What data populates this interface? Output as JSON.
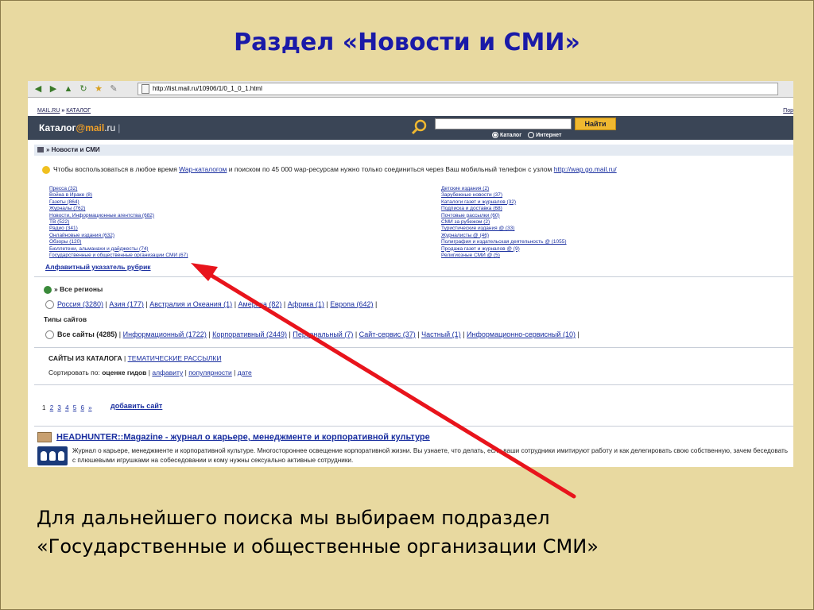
{
  "slide": {
    "title": "Раздел «Новости и СМИ»",
    "caption_line1": "Для дальнейшего поиска мы выбираем подраздел",
    "caption_line2": "«Государственные и общественные организации СМИ»"
  },
  "browser": {
    "url": "http://list.mail.ru/10906/1/0_1_0_1.html",
    "toolbar_icons": [
      "back-icon",
      "forward-icon",
      "up-icon",
      "refresh-icon",
      "favorites-icon",
      "edit-icon"
    ]
  },
  "site": {
    "breadcrumb": {
      "part1": "MAIL.RU",
      "sep": " » ",
      "part2": "КАТАЛОГ"
    },
    "breadcrumb_right": "Пор",
    "logo": {
      "word": "Каталог",
      "at": "@mail",
      "ru": ".ru",
      "bar": "|"
    },
    "search": {
      "button": "Найти",
      "opt1": "Каталог",
      "opt2": "Интернет"
    },
    "section": "» Новости и СМИ",
    "notice": {
      "pre": "Чтобы воспользоваться в любое время ",
      "link1": "Wap-каталогом",
      "mid": " и поиском по 45 000 wap-ресурсам нужно только соединиться через Ваш мобильный телефон с узлом ",
      "link2": "http://wap.go.mail.ru/"
    },
    "categories_left": [
      "Пресса (32)",
      "Война в Ираке (8)",
      "Газеты (864)",
      "Журналы (762)",
      "Новости, Информационные агентства (682)",
      "ТВ (522)",
      "Радио (341)",
      "Онлайновые издания (632)",
      "Обзоры (120)",
      "Бюллетени, альманахи и дайджесты (74)",
      "Государственные и общественные организации СМИ (67)"
    ],
    "categories_right": [
      "Детские издания (2)",
      "Зарубежные новости (37)",
      "Каталоги газет и журналов (32)",
      "Подписка и доставка (68)",
      "Почтовые рассылки (60)",
      "СМИ за рубежом (2)",
      "Туристические издания @ (33)",
      "Журналисты @ (46)",
      "Полиграфия и издательская деятельность @ (1055)",
      "Продажа газет и журналов @ (9)",
      "Религиозные СМИ @ (5)"
    ],
    "alpha_index": "Алфавитный указатель рубрик",
    "regions_title": "» Все регионы",
    "regions": [
      "Россия (3280)",
      "Азия (177)",
      "Австралия и Океания (1)",
      "Америка (82)",
      "Африка (1)",
      "Европа (642)"
    ],
    "types_title": "Типы сайтов",
    "types": [
      "Все сайты (4285)",
      "Информационный (1722)",
      "Корпоративный (2449)",
      "Персональный (7)",
      "Сайт-сервис (37)",
      "Частный (1)",
      "Информационно-сервисный (10)"
    ],
    "sites_head": {
      "title": "САЙТЫ ИЗ КАТАЛОГА",
      "sep": " | ",
      "link": "ТЕМАТИЧЕСКИЕ РАССЫЛКИ"
    },
    "sort": {
      "label": "Сортировать по: ",
      "current": "оценке гидов",
      "opt1": "алфавиту",
      "opt2": "популярности",
      "opt3": "дате"
    },
    "pages": [
      "1",
      "2",
      "3",
      "4",
      "5",
      "6",
      "»"
    ],
    "add_site": "добавить сайт",
    "result": {
      "title": "HEADHUNTER::Magazine - журнал о карьере, менеджменте и корпоративной культуре",
      "desc": "Журнал о карьере, менеджменте и корпоративной культуре. Многостороннее освещение корпоративной жизни. Вы узнаете, что делать, если ваши сотрудники имитируют работу и как делегировать свою собственную, зачем беседовать с плюшевыми игрушками на собеседовании и кому нужны сексуально активные сотрудники."
    }
  },
  "colors": {
    "background": "#e8d9a0",
    "title": "#1a1aa8",
    "link": "#1a2fa0",
    "header": "#3a4556",
    "button": "#f0b830",
    "arrow": "#e8141c"
  }
}
